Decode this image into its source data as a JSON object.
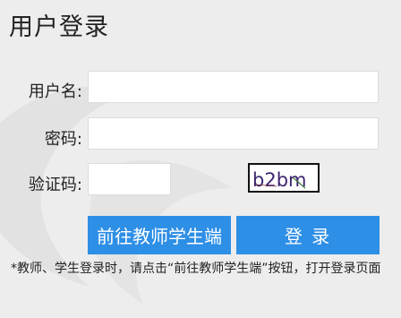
{
  "page": {
    "title": "用户登录"
  },
  "form": {
    "username_label": "用户名:",
    "username_value": "",
    "password_label": "密码:",
    "password_value": "",
    "captcha_label": "验证码:",
    "captcha_value": "",
    "captcha_image_text": "b2bm"
  },
  "buttons": {
    "student_teacher_label": "前往教师学生端",
    "login_label": "登 录"
  },
  "note": {
    "text": "*教师、学生登录时，请点击“前往教师学生端”按钮，打开登录页面"
  },
  "colors": {
    "accent": "#2e8fe6",
    "background": "#ededed"
  }
}
